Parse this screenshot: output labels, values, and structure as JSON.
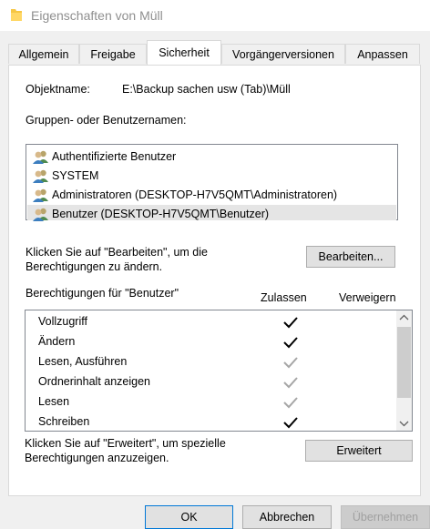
{
  "window": {
    "title": "Eigenschaften von Müll",
    "icon": "folder-icon"
  },
  "tabs": [
    {
      "label": "Allgemein"
    },
    {
      "label": "Freigabe"
    },
    {
      "label": "Sicherheit",
      "active": true
    },
    {
      "label": "Vorgängerversionen"
    },
    {
      "label": "Anpassen"
    }
  ],
  "security": {
    "object_label": "Objektname:",
    "object_value": "E:\\Backup sachen usw (Tab)\\Müll",
    "groups_label": "Gruppen- oder Benutzernamen:",
    "users": [
      {
        "label": "Authentifizierte Benutzer",
        "icon": "users-icon"
      },
      {
        "label": "SYSTEM",
        "icon": "users-icon"
      },
      {
        "label": "Administratoren (DESKTOP-H7V5QMT\\Administratoren)",
        "icon": "users-icon"
      },
      {
        "label": "Benutzer (DESKTOP-H7V5QMT\\Benutzer)",
        "icon": "users-icon",
        "selected": true
      }
    ],
    "edit_hint": "Klicken Sie auf \"Bearbeiten\", um die Berechtigungen zu ändern.",
    "edit_button": "Bearbeiten...",
    "permissions_label": "Berechtigungen für \"Benutzer\"",
    "allow_header": "Zulassen",
    "deny_header": "Verweigern",
    "permissions": [
      {
        "name": "Vollzugriff",
        "allow": "black",
        "deny": false
      },
      {
        "name": "Ändern",
        "allow": "black",
        "deny": false
      },
      {
        "name": "Lesen, Ausführen",
        "allow": "gray",
        "deny": false
      },
      {
        "name": "Ordnerinhalt anzeigen",
        "allow": "gray",
        "deny": false
      },
      {
        "name": "Lesen",
        "allow": "gray",
        "deny": false
      },
      {
        "name": "Schreiben",
        "allow": "black",
        "deny": false
      }
    ],
    "advanced_hint": "Klicken Sie auf \"Erweitert\", um spezielle Berechtigungen anzuzeigen.",
    "advanced_button": "Erweitert"
  },
  "footer": {
    "ok": "OK",
    "cancel": "Abbrechen",
    "apply": "Übernehmen"
  },
  "colors": {
    "checked_black": "#000000",
    "checked_gray": "#a6a6a6",
    "selection": "#e5e5e5",
    "accent": "#0078d7"
  }
}
